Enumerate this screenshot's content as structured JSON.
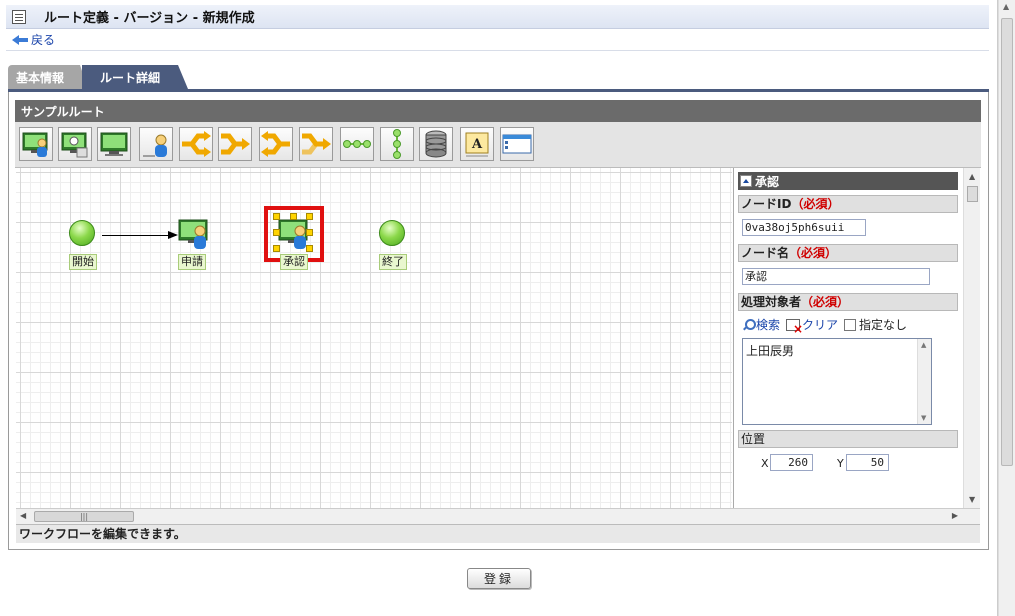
{
  "header": {
    "title": "ルート定義 - バージョン - 新規作成",
    "back_label": "戻る"
  },
  "tabs": [
    {
      "label": "基本情報",
      "active": false
    },
    {
      "label": "ルート詳細",
      "active": true
    }
  ],
  "route": {
    "name": "サンプルルート"
  },
  "toolbar": {
    "tools": [
      "user-node-icon",
      "role-node-icon",
      "system-node-icon",
      "person-icon",
      "split-branch-icon",
      "merge-branch-icon",
      "split-merge-icon",
      "branch-right-icon",
      "path-horizontal-icon",
      "path-vertical-icon",
      "database-icon",
      "text-label-icon",
      "form-window-icon"
    ]
  },
  "canvas": {
    "nodes": [
      {
        "label": "開始",
        "type": "start"
      },
      {
        "label": "申請",
        "type": "user"
      },
      {
        "label": "承認",
        "type": "user",
        "selected": true
      },
      {
        "label": "終了",
        "type": "end"
      }
    ]
  },
  "status": "ワークフローを編集できます。",
  "panel": {
    "title": "承認",
    "node_id_label": "ノードID",
    "node_id_value": "0va38oj5ph6suii",
    "node_name_label": "ノード名",
    "node_name_value": "承認",
    "required_mark": "（必須）",
    "assignee_label": "処理対象者",
    "search_label": "検索",
    "clear_label": "クリア",
    "unspecified_label": "指定なし",
    "assignee_value": "上田辰男",
    "position_label": "位置",
    "x_label": "X",
    "x_value": "260",
    "y_label": "Y",
    "y_value": "50"
  },
  "footer": {
    "register_label": "登録"
  },
  "colors": {
    "tab_active": "#4b5b7e",
    "selection": "#e01010",
    "required": "#d00000",
    "link": "#1a44aa"
  }
}
